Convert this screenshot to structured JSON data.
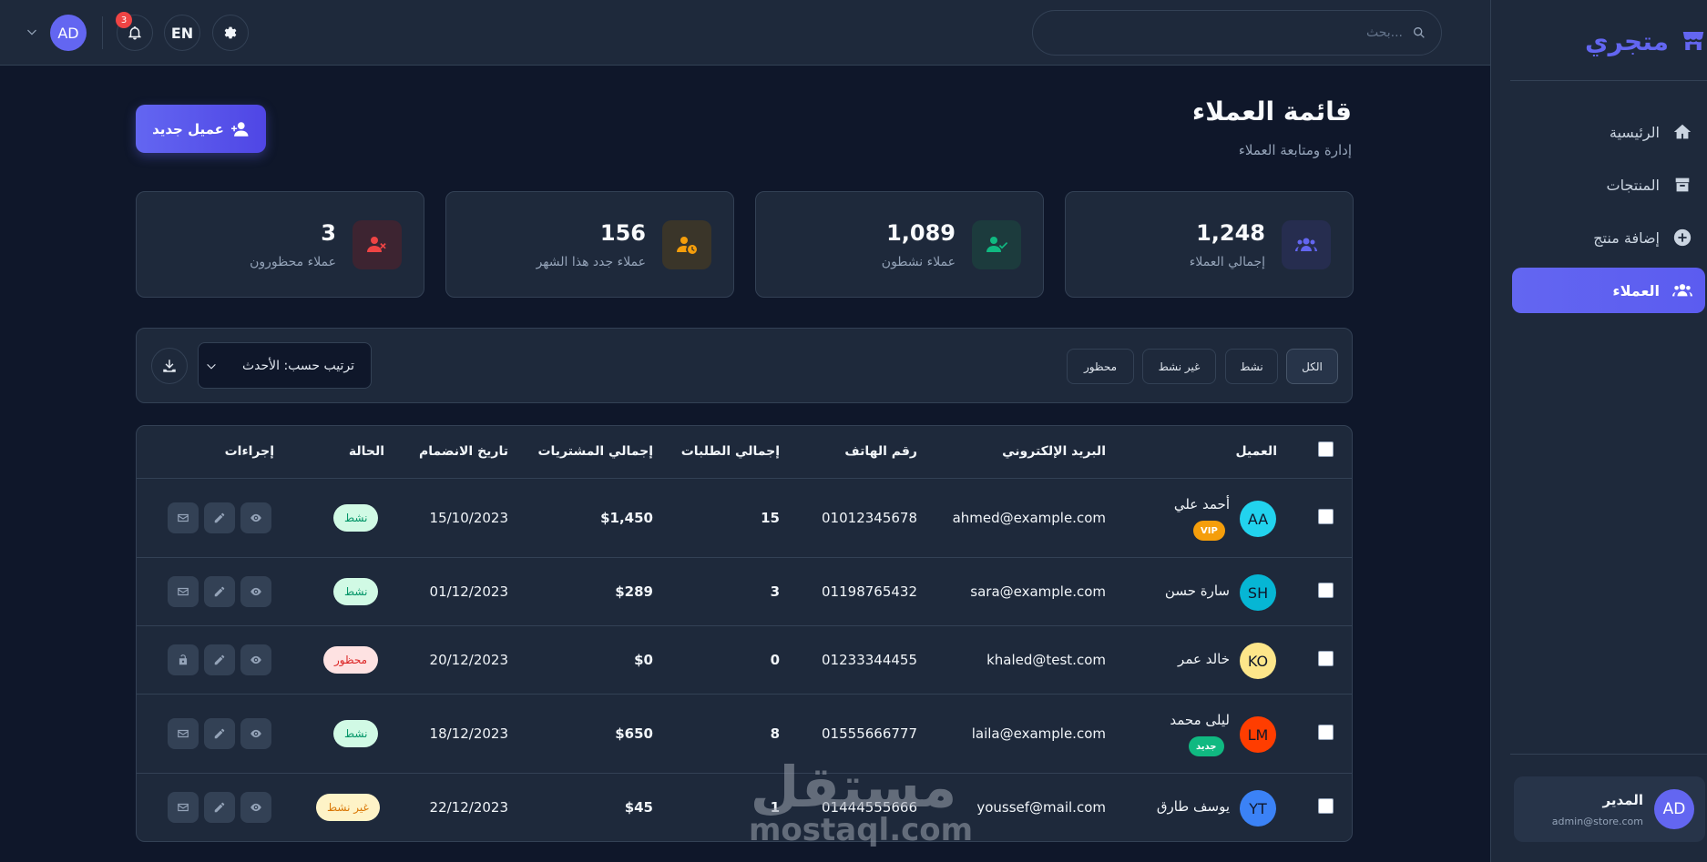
{
  "brand": {
    "name": "متجري"
  },
  "nav": [
    {
      "label": "الرئيسية",
      "icon": "home-icon"
    },
    {
      "label": "المنتجات",
      "icon": "box-icon"
    },
    {
      "label": "إضافة منتج",
      "icon": "plus-circle-icon"
    },
    {
      "label": "العملاء",
      "icon": "users-icon",
      "active": true
    }
  ],
  "user": {
    "name": "المدير",
    "email": "admin@store.com",
    "initials": "AD"
  },
  "header": {
    "search_placeholder": "بحث...",
    "notifications_count": "3",
    "lang": "EN",
    "avatar": "AD"
  },
  "page": {
    "title": "قائمة العملاء",
    "subtitle": "إدارة ومتابعة العملاء",
    "new_button": "عميل جديد"
  },
  "stats": [
    {
      "value": "1,248",
      "label": "إجمالي العملاء",
      "icon": "users-icon",
      "color": "#6366f1",
      "bg": "#262d4f"
    },
    {
      "value": "1,089",
      "label": "عملاء نشطون",
      "icon": "user-check-icon",
      "color": "#10b981",
      "bg": "#1c3b3d"
    },
    {
      "value": "156",
      "label": "عملاء جدد هذا الشهر",
      "icon": "user-clock-icon",
      "color": "#f59e0b",
      "bg": "#3a3529"
    },
    {
      "value": "3",
      "label": "عملاء محظورون",
      "icon": "user-times-icon",
      "color": "#ef4444",
      "bg": "#3d2431"
    }
  ],
  "filters": {
    "all": "الكل",
    "active": "نشط",
    "inactive": "غير نشط",
    "banned": "محظور",
    "sort": "ترتيب حسب: الأحدث"
  },
  "table": {
    "headers": {
      "customer": "العميل",
      "email": "البريد الإلكتروني",
      "phone": "رقم الهاتف",
      "orders": "إجمالي الطلبات",
      "purchases": "إجمالي المشتريات",
      "joined": "تاريخ الانضمام",
      "status": "الحالة",
      "actions": "إجراءات"
    },
    "rows": [
      {
        "initials": "AA",
        "avatar_color": "#22d3ee",
        "name": "أحمد علي",
        "tag": "VIP",
        "email": "ahmed@example.com",
        "phone": "01012345678",
        "orders": "15",
        "purchases": "$1,450",
        "joined": "15/10/2023",
        "status": "نشط"
      },
      {
        "initials": "SH",
        "avatar_color": "#06b6d4",
        "name": "سارة حسن",
        "tag": "",
        "email": "sara@example.com",
        "phone": "01198765432",
        "orders": "3",
        "purchases": "$289",
        "joined": "01/12/2023",
        "status": "نشط"
      },
      {
        "initials": "KO",
        "avatar_color": "#fde68a",
        "name": "خالد عمر",
        "tag": "",
        "email": "khaled@test.com",
        "phone": "01233344455",
        "orders": "0",
        "purchases": "$0",
        "joined": "20/12/2023",
        "status": "محظور"
      },
      {
        "initials": "LM",
        "avatar_color": "#ff3d00",
        "name": "ليلى محمد",
        "tag": "جديد",
        "email": "laila@example.com",
        "phone": "01555666777",
        "orders": "8",
        "purchases": "$650",
        "joined": "18/12/2023",
        "status": "نشط"
      },
      {
        "initials": "YT",
        "avatar_color": "#3b82f6",
        "name": "يوسف طارق",
        "tag": "",
        "email": "youssef@mail.com",
        "phone": "01444555666",
        "orders": "1",
        "purchases": "$45",
        "joined": "22/12/2023",
        "status": "غير نشط"
      }
    ]
  },
  "watermark": {
    "ar": "مستقل",
    "en": "mostaql.com"
  }
}
